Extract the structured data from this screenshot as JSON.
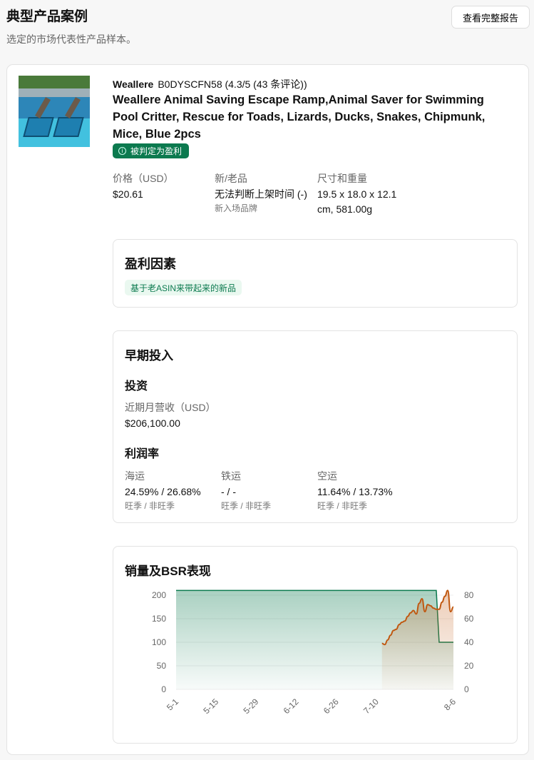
{
  "header": {
    "title": "典型产品案例",
    "subtitle": "选定的市场代表性产品样本。",
    "report_button": "查看完整报告"
  },
  "product": {
    "brand": "Weallere",
    "asin_rating": "B0DYSCFN58 (4.3/5 (43 条评论))",
    "title": "Weallere Animal Saving Escape Ramp,Animal Saver for Swimming Pool Critter, Rescue for Toads, Lizards, Ducks, Snakes, Chipmunk, Mice, Blue 2pcs",
    "badge": "被判定为盈利",
    "price_label": "价格（USD）",
    "price": "$20.61",
    "age_label": "新/老品",
    "age_value": "无法判断上架时间 (-)",
    "age_sub": "新入场品牌",
    "size_label": "尺寸和重量",
    "size_value": "19.5 x 18.0 x 12.1 cm, 581.00g"
  },
  "profit_factors": {
    "title": "盈利因素",
    "tags": [
      "基于老ASIN来带起来的新品"
    ]
  },
  "investment": {
    "title": "早期投入",
    "invest_heading": "投资",
    "revenue_label": "近期月营收（USD）",
    "revenue": "$206,100.00",
    "margin_heading": "利润率",
    "margins": [
      {
        "label": "海运",
        "value": "24.59% / 26.68%",
        "sub": "旺季 / 非旺季"
      },
      {
        "label": "铁运",
        "value": "- / -",
        "sub": "旺季 / 非旺季"
      },
      {
        "label": "空运",
        "value": "11.64% / 13.73%",
        "sub": "旺季 / 非旺季"
      }
    ]
  },
  "colors": {
    "accent": "#0c7a4f",
    "orange": "#c0570f"
  },
  "chart_data": {
    "type": "line",
    "title": "销量及BSR表现",
    "x_ticks": [
      "5-1",
      "5-15",
      "5-29",
      "6-12",
      "6-26",
      "7-10",
      "8-6"
    ],
    "x_tick_days": [
      0,
      14,
      28,
      42,
      56,
      70,
      97
    ],
    "x_range_days": [
      0,
      97
    ],
    "left_axis": {
      "ticks": [
        0,
        50,
        100,
        150,
        200
      ],
      "range": [
        0,
        200
      ]
    },
    "right_axis": {
      "ticks": [
        0,
        20,
        40,
        60,
        80
      ],
      "range": [
        0,
        80
      ]
    },
    "series": [
      {
        "name": "green",
        "axis": "left",
        "days": [
          0,
          91,
          92,
          97
        ],
        "values": [
          210,
          210,
          100,
          100
        ]
      },
      {
        "name": "orange",
        "axis": "right",
        "days": [
          72,
          73,
          74,
          75,
          76,
          77,
          78,
          79,
          80,
          81,
          82,
          83,
          84,
          85,
          86,
          87,
          88,
          89,
          90,
          91,
          92,
          93,
          94,
          95,
          96,
          97
        ],
        "values": [
          39,
          38,
          42,
          46,
          50,
          51,
          55,
          57,
          58,
          62,
          65,
          67,
          64,
          73,
          77,
          66,
          72,
          71,
          69,
          68,
          68,
          74,
          79,
          84,
          66,
          70
        ]
      }
    ]
  }
}
